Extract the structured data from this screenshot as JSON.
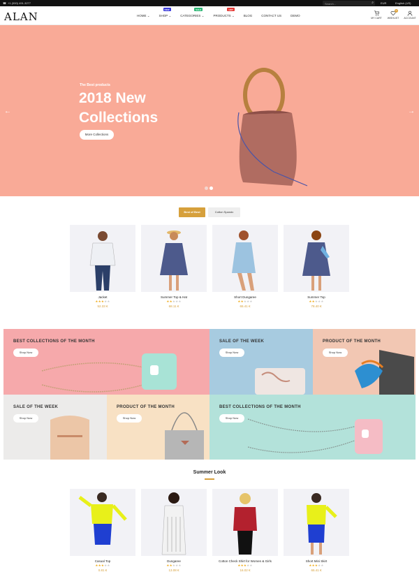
{
  "topbar": {
    "phone": "+1 (000) 491-3277",
    "search_placeholder": "Search...",
    "currency": "EUR",
    "language": "English (US)"
  },
  "brand": {
    "logo": "ALAN"
  },
  "nav": [
    {
      "label": "HOME",
      "badge": ""
    },
    {
      "label": "SHOP",
      "badge": "NEW",
      "badge_color": "#3b3bdb"
    },
    {
      "label": "CATEGORIES",
      "badge": "SALE",
      "badge_color": "#2bb673"
    },
    {
      "label": "PRODUCTS",
      "badge": "HOT",
      "badge_color": "#e53935"
    },
    {
      "label": "BLOG",
      "badge": ""
    },
    {
      "label": "CONTACT US",
      "badge": ""
    },
    {
      "label": "DEMO",
      "badge": ""
    }
  ],
  "header_icons": {
    "cart": "MY CART",
    "wishlist": "WISHLIST",
    "wishlist_count": "0",
    "account": "ACCOUNT"
  },
  "hero": {
    "subtitle": "The Best products",
    "title": "2018 New Collections",
    "cta": "More Collections"
  },
  "tabs": {
    "active": "Best of Best",
    "other": "Cotton Spandx"
  },
  "products_top": [
    {
      "name": "Jacket",
      "rating": 3,
      "price": "52.33 €"
    },
    {
      "name": "Summer Top & Hat",
      "rating": 2,
      "price": "68.11 €"
    },
    {
      "name": "Short Dungaree",
      "rating": 2,
      "price": "65.41 €"
    },
    {
      "name": "Summer Top",
      "rating": 2,
      "price": "78.40 €"
    }
  ],
  "banners": [
    {
      "title": "BEST COLLECTIONS OF THE MONTH",
      "button": "Shop Now"
    },
    {
      "title": "SALE OF THE WEEK",
      "button": "Shop Now"
    },
    {
      "title": "PRODUCT OF THE MONTH",
      "button": "Shop Now"
    },
    {
      "title": "SALE OF THE WEEK",
      "button": "Shop Now"
    },
    {
      "title": "PRODUCT OF THE MONTH",
      "button": "Shop Now"
    },
    {
      "title": "BEST COLLECTIONS OF THE MONTH",
      "button": "Shop Now"
    }
  ],
  "summer": {
    "title": "Summer Look"
  },
  "products_bottom": [
    {
      "name": "Casual Top",
      "rating": 3,
      "price": "0.81 €"
    },
    {
      "name": "Dungaree",
      "rating": 2,
      "price": "13.08 €"
    },
    {
      "name": "Cotton Check Shirt for Women & Girls",
      "rating": 3,
      "price": "16.02 €"
    },
    {
      "name": "Short Mini Skirt",
      "rating": 3,
      "price": "65.41 €"
    }
  ],
  "colors": {
    "accent": "#d6a03c",
    "hero_bg": "#f9aa97",
    "star": "#f0ad1d"
  },
  "icons": [
    "phone-icon",
    "search-icon",
    "cart-icon",
    "heart-icon",
    "user-icon",
    "arrow-left-icon",
    "arrow-right-icon",
    "star-icon"
  ]
}
